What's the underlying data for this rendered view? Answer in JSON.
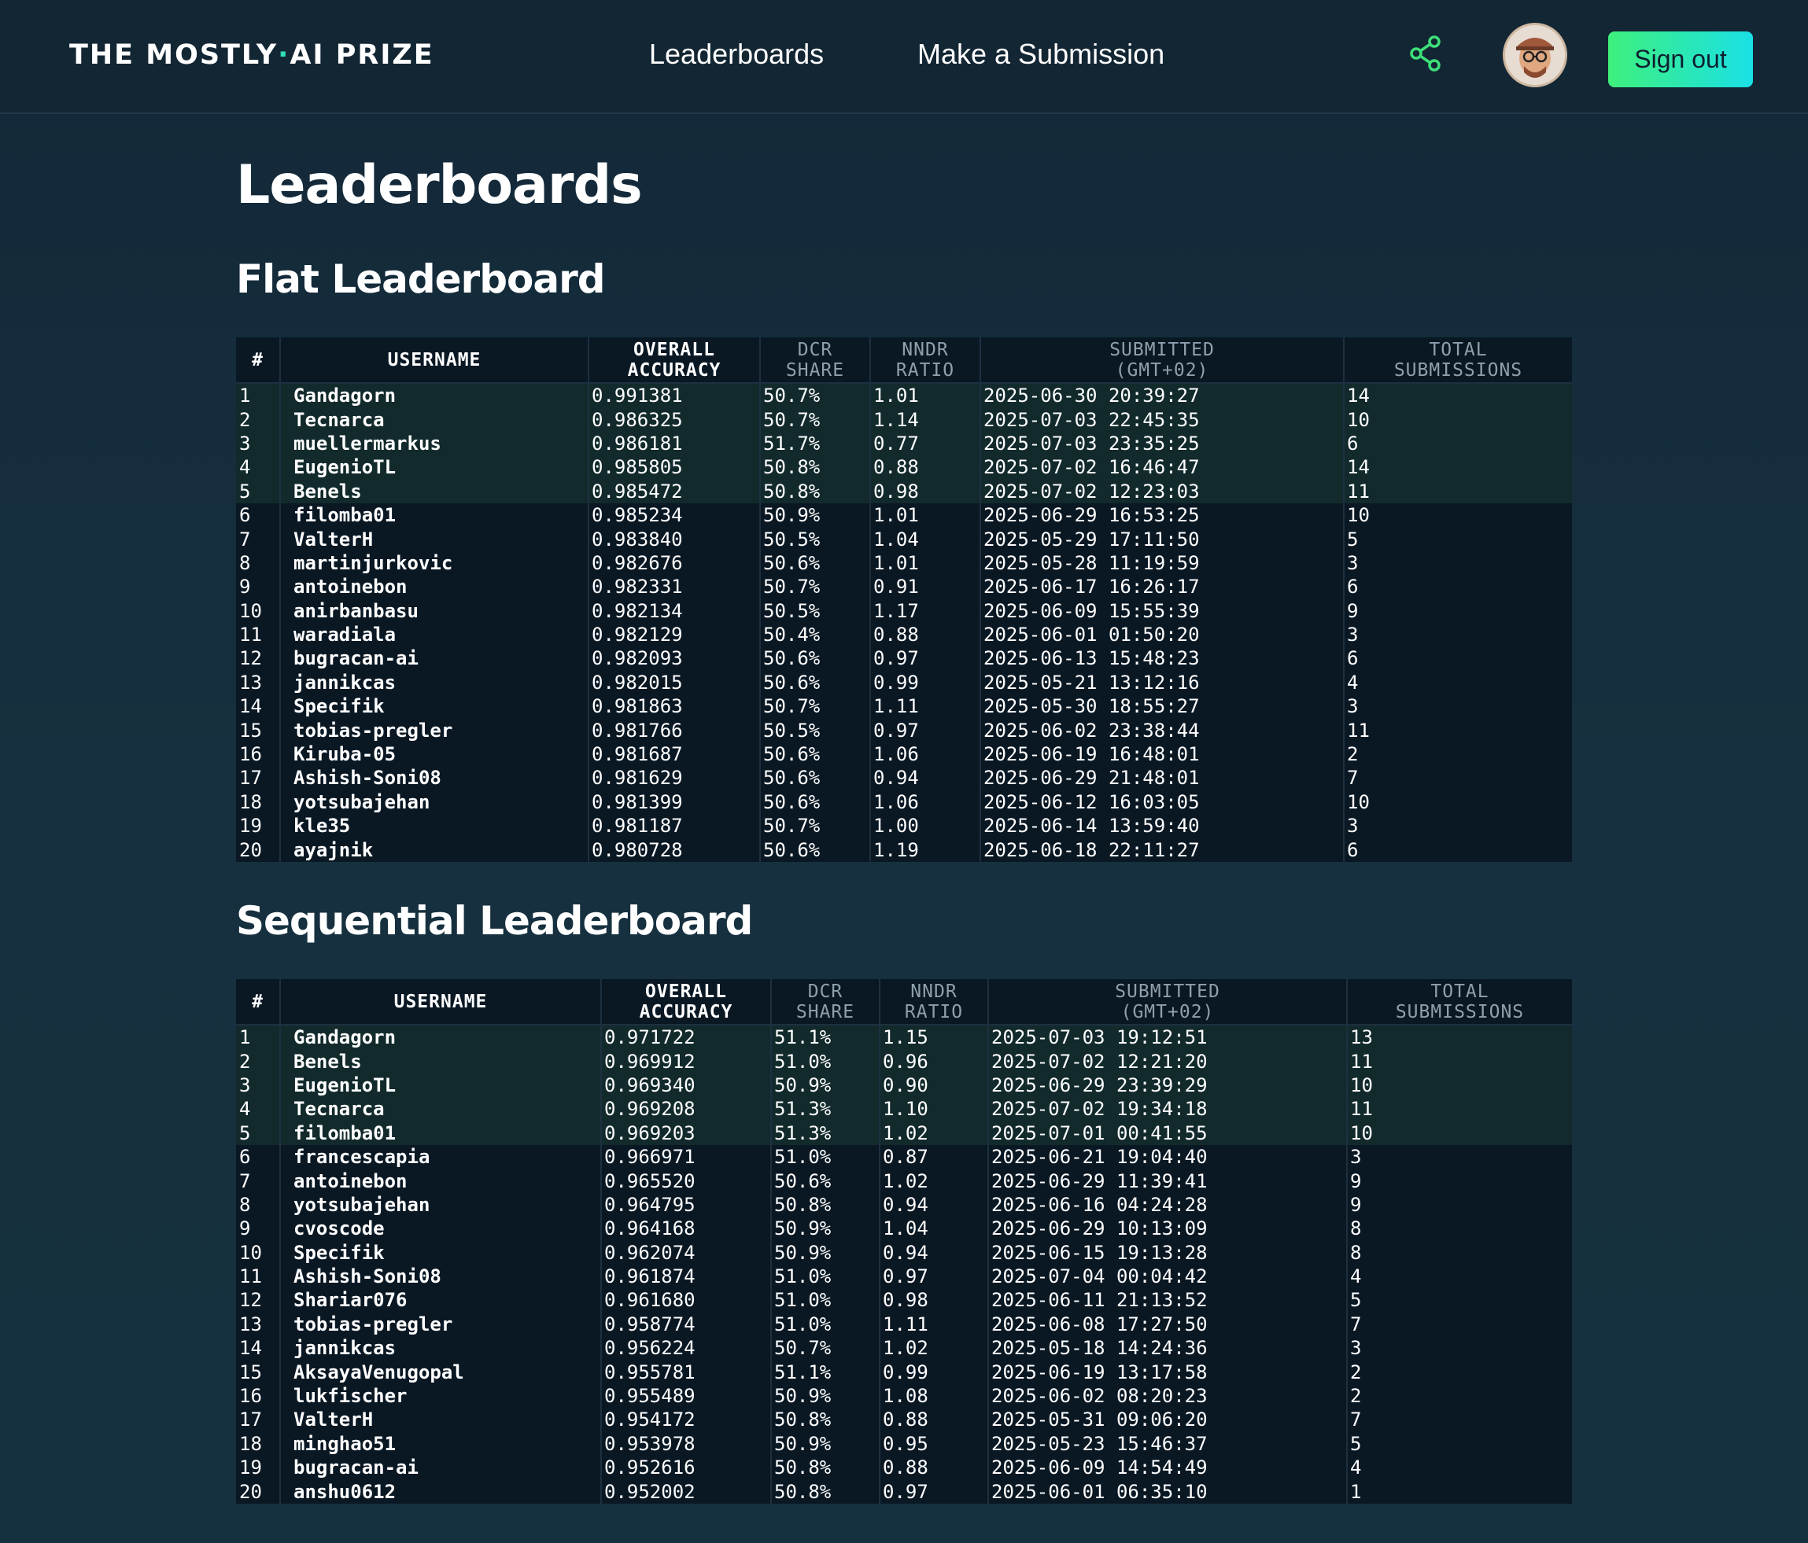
{
  "header": {
    "logo": {
      "left": "THE MOSTLY",
      "dot": "·",
      "right": "AI PRIZE"
    },
    "nav": [
      "Leaderboards",
      "Make a Submission"
    ],
    "signout_label": "Sign out",
    "accent": "#2fe0b4"
  },
  "page_title": "Leaderboards",
  "columns": [
    {
      "line1": "#",
      "line2": ""
    },
    {
      "line1": "USERNAME",
      "line2": ""
    },
    {
      "line1": "OVERALL",
      "line2": "ACCURACY"
    },
    {
      "line1": "DCR",
      "line2": "SHARE"
    },
    {
      "line1": "NNDR",
      "line2": "RATIO"
    },
    {
      "line1": "SUBMITTED",
      "line2": "(GMT+02)"
    },
    {
      "line1": "TOTAL",
      "line2": "SUBMISSIONS"
    }
  ],
  "flat": {
    "title": "Flat Leaderboard",
    "rows": [
      [
        "1",
        "Gandagorn",
        "0.991381",
        "50.7%",
        "1.01",
        "2025-06-30 20:39:27",
        "14"
      ],
      [
        "2",
        "Tecnarca",
        "0.986325",
        "50.7%",
        "1.14",
        "2025-07-03 22:45:35",
        "10"
      ],
      [
        "3",
        "muellermarkus",
        "0.986181",
        "51.7%",
        "0.77",
        "2025-07-03 23:35:25",
        "6"
      ],
      [
        "4",
        "EugenioTL",
        "0.985805",
        "50.8%",
        "0.88",
        "2025-07-02 16:46:47",
        "14"
      ],
      [
        "5",
        "Benels",
        "0.985472",
        "50.8%",
        "0.98",
        "2025-07-02 12:23:03",
        "11"
      ],
      [
        "6",
        "filomba01",
        "0.985234",
        "50.9%",
        "1.01",
        "2025-06-29 16:53:25",
        "10"
      ],
      [
        "7",
        "ValterH",
        "0.983840",
        "50.5%",
        "1.04",
        "2025-05-29 17:11:50",
        "5"
      ],
      [
        "8",
        "martinjurkovic",
        "0.982676",
        "50.6%",
        "1.01",
        "2025-05-28 11:19:59",
        "3"
      ],
      [
        "9",
        "antoinebon",
        "0.982331",
        "50.7%",
        "0.91",
        "2025-06-17 16:26:17",
        "6"
      ],
      [
        "10",
        "anirbanbasu",
        "0.982134",
        "50.5%",
        "1.17",
        "2025-06-09 15:55:39",
        "9"
      ],
      [
        "11",
        "waradiala",
        "0.982129",
        "50.4%",
        "0.88",
        "2025-06-01 01:50:20",
        "3"
      ],
      [
        "12",
        "bugracan-ai",
        "0.982093",
        "50.6%",
        "0.97",
        "2025-06-13 15:48:23",
        "6"
      ],
      [
        "13",
        "jannikcas",
        "0.982015",
        "50.6%",
        "0.99",
        "2025-05-21 13:12:16",
        "4"
      ],
      [
        "14",
        "Specifik",
        "0.981863",
        "50.7%",
        "1.11",
        "2025-05-30 18:55:27",
        "3"
      ],
      [
        "15",
        "tobias-pregler",
        "0.981766",
        "50.5%",
        "0.97",
        "2025-06-02 23:38:44",
        "11"
      ],
      [
        "16",
        "Kiruba-05",
        "0.981687",
        "50.6%",
        "1.06",
        "2025-06-19 16:48:01",
        "2"
      ],
      [
        "17",
        "Ashish-Soni08",
        "0.981629",
        "50.6%",
        "0.94",
        "2025-06-29 21:48:01",
        "7"
      ],
      [
        "18",
        "yotsubajehan",
        "0.981399",
        "50.6%",
        "1.06",
        "2025-06-12 16:03:05",
        "10"
      ],
      [
        "19",
        "kle35",
        "0.981187",
        "50.7%",
        "1.00",
        "2025-06-14 13:59:40",
        "3"
      ],
      [
        "20",
        "ayajnik",
        "0.980728",
        "50.6%",
        "1.19",
        "2025-06-18 22:11:27",
        "6"
      ]
    ]
  },
  "sequential": {
    "title": "Sequential Leaderboard",
    "rows": [
      [
        "1",
        "Gandagorn",
        "0.971722",
        "51.1%",
        "1.15",
        "2025-07-03 19:12:51",
        "13"
      ],
      [
        "2",
        "Benels",
        "0.969912",
        "51.0%",
        "0.96",
        "2025-07-02 12:21:20",
        "11"
      ],
      [
        "3",
        "EugenioTL",
        "0.969340",
        "50.9%",
        "0.90",
        "2025-06-29 23:39:29",
        "10"
      ],
      [
        "4",
        "Tecnarca",
        "0.969208",
        "51.3%",
        "1.10",
        "2025-07-02 19:34:18",
        "11"
      ],
      [
        "5",
        "filomba01",
        "0.969203",
        "51.3%",
        "1.02",
        "2025-07-01 00:41:55",
        "10"
      ],
      [
        "6",
        "francescapia",
        "0.966971",
        "51.0%",
        "0.87",
        "2025-06-21 19:04:40",
        "3"
      ],
      [
        "7",
        "antoinebon",
        "0.965520",
        "50.6%",
        "1.02",
        "2025-06-29 11:39:41",
        "9"
      ],
      [
        "8",
        "yotsubajehan",
        "0.964795",
        "50.8%",
        "0.94",
        "2025-06-16 04:24:28",
        "9"
      ],
      [
        "9",
        "cvoscode",
        "0.964168",
        "50.9%",
        "1.04",
        "2025-06-29 10:13:09",
        "8"
      ],
      [
        "10",
        "Specifik",
        "0.962074",
        "50.9%",
        "0.94",
        "2025-06-15 19:13:28",
        "8"
      ],
      [
        "11",
        "Ashish-Soni08",
        "0.961874",
        "51.0%",
        "0.97",
        "2025-07-04 00:04:42",
        "4"
      ],
      [
        "12",
        "Shariar076",
        "0.961680",
        "51.0%",
        "0.98",
        "2025-06-11 21:13:52",
        "5"
      ],
      [
        "13",
        "tobias-pregler",
        "0.958774",
        "51.0%",
        "1.11",
        "2025-06-08 17:27:50",
        "7"
      ],
      [
        "14",
        "jannikcas",
        "0.956224",
        "50.7%",
        "1.02",
        "2025-05-18 14:24:36",
        "3"
      ],
      [
        "15",
        "AksayaVenugopal",
        "0.955781",
        "51.1%",
        "0.99",
        "2025-06-19 13:17:58",
        "2"
      ],
      [
        "16",
        "lukfischer",
        "0.955489",
        "50.9%",
        "1.08",
        "2025-06-02 08:20:23",
        "2"
      ],
      [
        "17",
        "ValterH",
        "0.954172",
        "50.8%",
        "0.88",
        "2025-05-31 09:06:20",
        "7"
      ],
      [
        "18",
        "minghao51",
        "0.953978",
        "50.9%",
        "0.95",
        "2025-05-23 15:46:37",
        "5"
      ],
      [
        "19",
        "bugracan-ai",
        "0.952616",
        "50.8%",
        "0.88",
        "2025-06-09 14:54:49",
        "4"
      ],
      [
        "20",
        "anshu0612",
        "0.952002",
        "50.8%",
        "0.97",
        "2025-06-01 06:35:10",
        "1"
      ]
    ]
  }
}
